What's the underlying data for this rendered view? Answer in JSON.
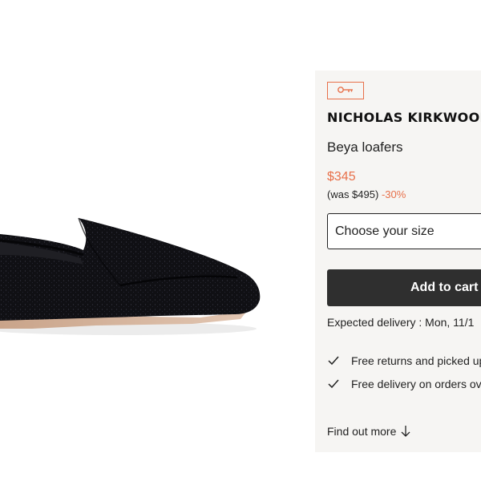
{
  "product": {
    "image_alt": "Black pointed loafer",
    "brand": "NICHOLAS KIRKWOOD",
    "name": "Beya loafers",
    "price": "$345",
    "was_price": "(was $495)",
    "discount": "-30%"
  },
  "size_select": {
    "placeholder": "Choose your size"
  },
  "cart": {
    "button_label": "Add to cart"
  },
  "delivery": {
    "text": "Expected delivery : Mon, 11/1"
  },
  "benefits": [
    {
      "label": "Free returns and picked up"
    },
    {
      "label": "Free delivery on orders ov"
    }
  ],
  "find_out_more": {
    "label": "Find out more"
  },
  "icons": {
    "badge": "key-icon",
    "benefit": "checkmark-icon",
    "more": "arrow-down-icon"
  },
  "colors": {
    "accent": "#e8704a",
    "button_bg": "#2f2f2f",
    "panel_bg": "#f6f5f3"
  }
}
